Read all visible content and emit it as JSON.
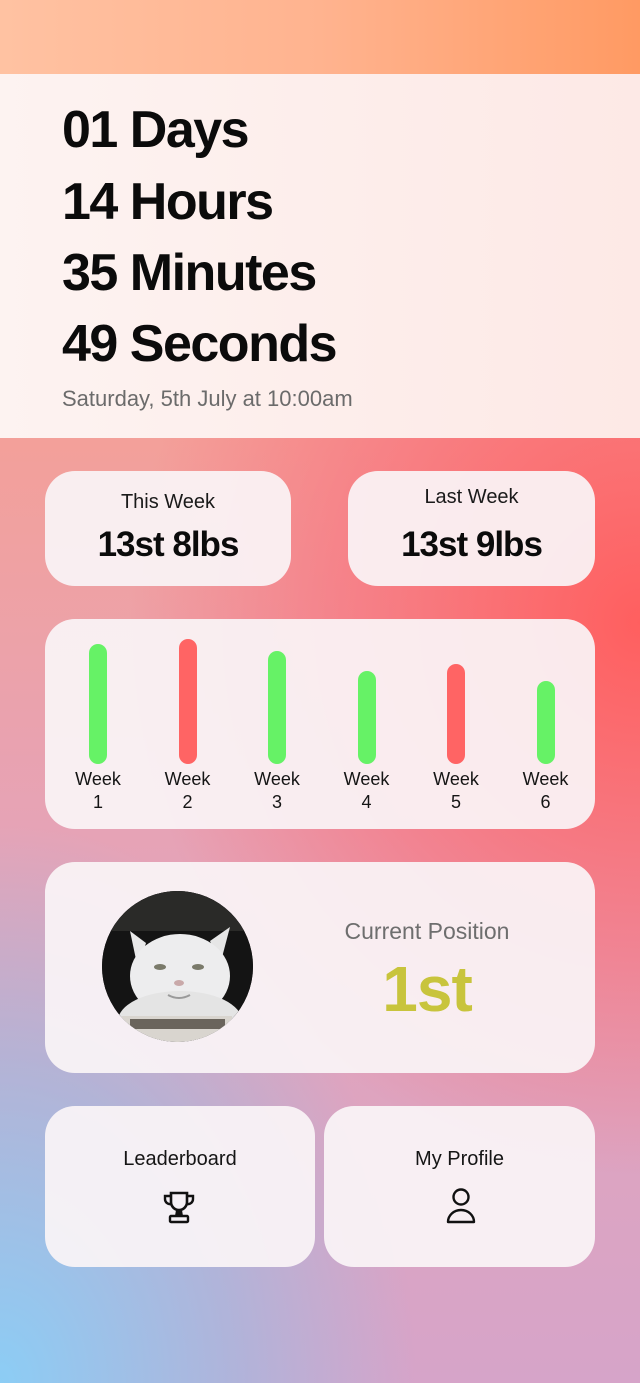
{
  "countdown": {
    "days": "01 Days",
    "hours": "14 Hours",
    "minutes": "35 Minutes",
    "seconds": "49 Seconds",
    "event_date": "Saturday, 5th July at 10:00am"
  },
  "weights": {
    "this_week_label": "This Week",
    "this_week_value": "13st 8lbs",
    "last_week_label": "Last Week",
    "last_week_value": "13st 9lbs"
  },
  "chart_data": {
    "type": "bar",
    "categories": [
      "Week\n1",
      "Week\n2",
      "Week\n3",
      "Week\n4",
      "Week\n5",
      "Week\n6"
    ],
    "values": [
      1.0,
      1.04,
      0.94,
      0.77,
      0.83,
      0.69
    ],
    "colors": [
      "#66f266",
      "#ff6464",
      "#66f266",
      "#66f266",
      "#ff6464",
      "#66f266"
    ],
    "title": "",
    "xlabel": "",
    "ylabel": ""
  },
  "position": {
    "label": "Current Position",
    "value": "1st",
    "value_color": "#c8c43c",
    "avatar": "cat-avatar"
  },
  "nav": {
    "leaderboard_label": "Leaderboard",
    "leaderboard_icon": "trophy-icon",
    "profile_label": "My Profile",
    "profile_icon": "person-icon"
  }
}
